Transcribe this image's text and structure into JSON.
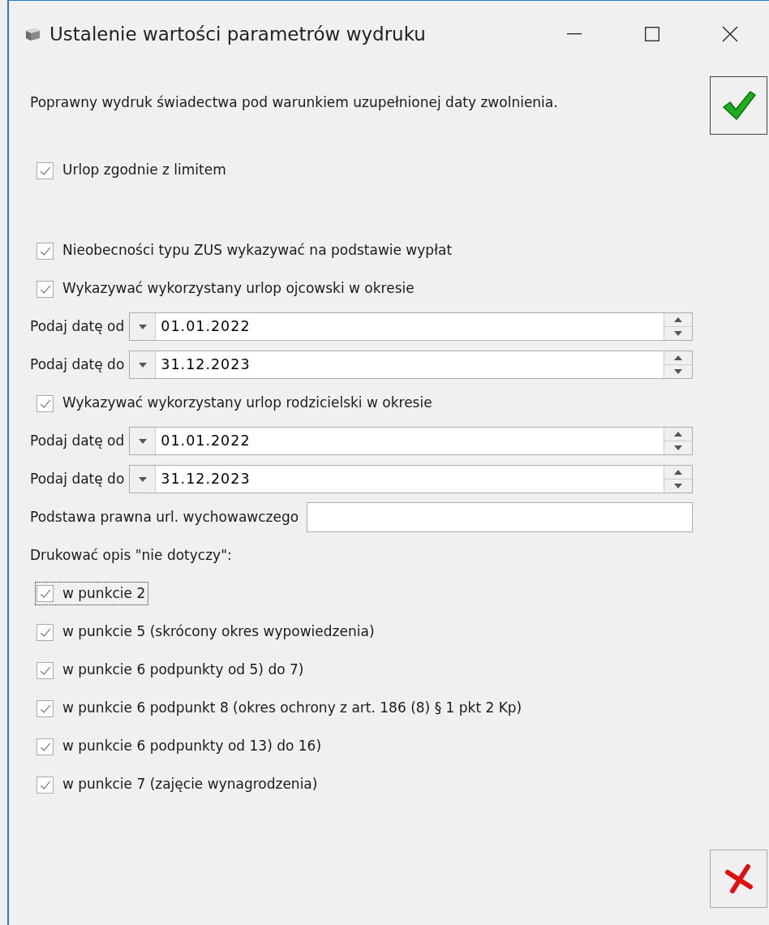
{
  "window": {
    "title": "Ustalenie wartości parametrów wydruku"
  },
  "message": "Poprawny wydruk świadectwa pod warunkiem uzupełnionej daty zwolnienia.",
  "groups": [
    {
      "items": [
        {
          "kind": "checkbox",
          "label": "Urlop zgodnie z limitem",
          "checked": true,
          "focused": false
        }
      ]
    },
    {
      "items": [
        {
          "kind": "checkbox",
          "label": "Nieobecności typu ZUS wykazywać na podstawie wypłat",
          "checked": true,
          "focused": false
        },
        {
          "kind": "checkbox",
          "label": "Wykazywać wykorzystany urlop ojcowski w okresie",
          "checked": true,
          "focused": false
        },
        {
          "kind": "date",
          "label": "Podaj datę od",
          "value": "01.01.2022"
        },
        {
          "kind": "date",
          "label": "Podaj datę do",
          "value": "31.12.2023"
        },
        {
          "kind": "checkbox",
          "label": "Wykazywać wykorzystany urlop rodzicielski w okresie",
          "checked": true,
          "focused": false
        },
        {
          "kind": "date",
          "label": "Podaj datę od",
          "value": "01.01.2022"
        },
        {
          "kind": "date",
          "label": "Podaj datę do",
          "value": "31.12.2023"
        },
        {
          "kind": "text",
          "label": "Podstawa prawna url. wychowawczego"
        },
        {
          "kind": "label",
          "label": "Drukować opis \"nie dotyczy\":"
        },
        {
          "kind": "checkbox",
          "label": "w punkcie 2",
          "checked": true,
          "focused": true
        },
        {
          "kind": "checkbox",
          "label": "w punkcie 5 (skrócony okres wypowiedzenia)",
          "checked": true,
          "focused": false
        },
        {
          "kind": "checkbox",
          "label": "w punkcie 6 podpunkty od 5) do 7)",
          "checked": true,
          "focused": false
        },
        {
          "kind": "checkbox",
          "label": "w punkcie 6 podpunkt 8 (okres ochrony z art. 186 (8) § 1 pkt 2 Kp)",
          "checked": true,
          "focused": false
        },
        {
          "kind": "checkbox",
          "label": "w punkcie 6 podpunkty od 13) do 16)",
          "checked": true,
          "focused": false
        },
        {
          "kind": "checkbox",
          "label": "w punkcie 7 (zajęcie wynagrodzenia)",
          "checked": true,
          "focused": false
        }
      ]
    }
  ]
}
